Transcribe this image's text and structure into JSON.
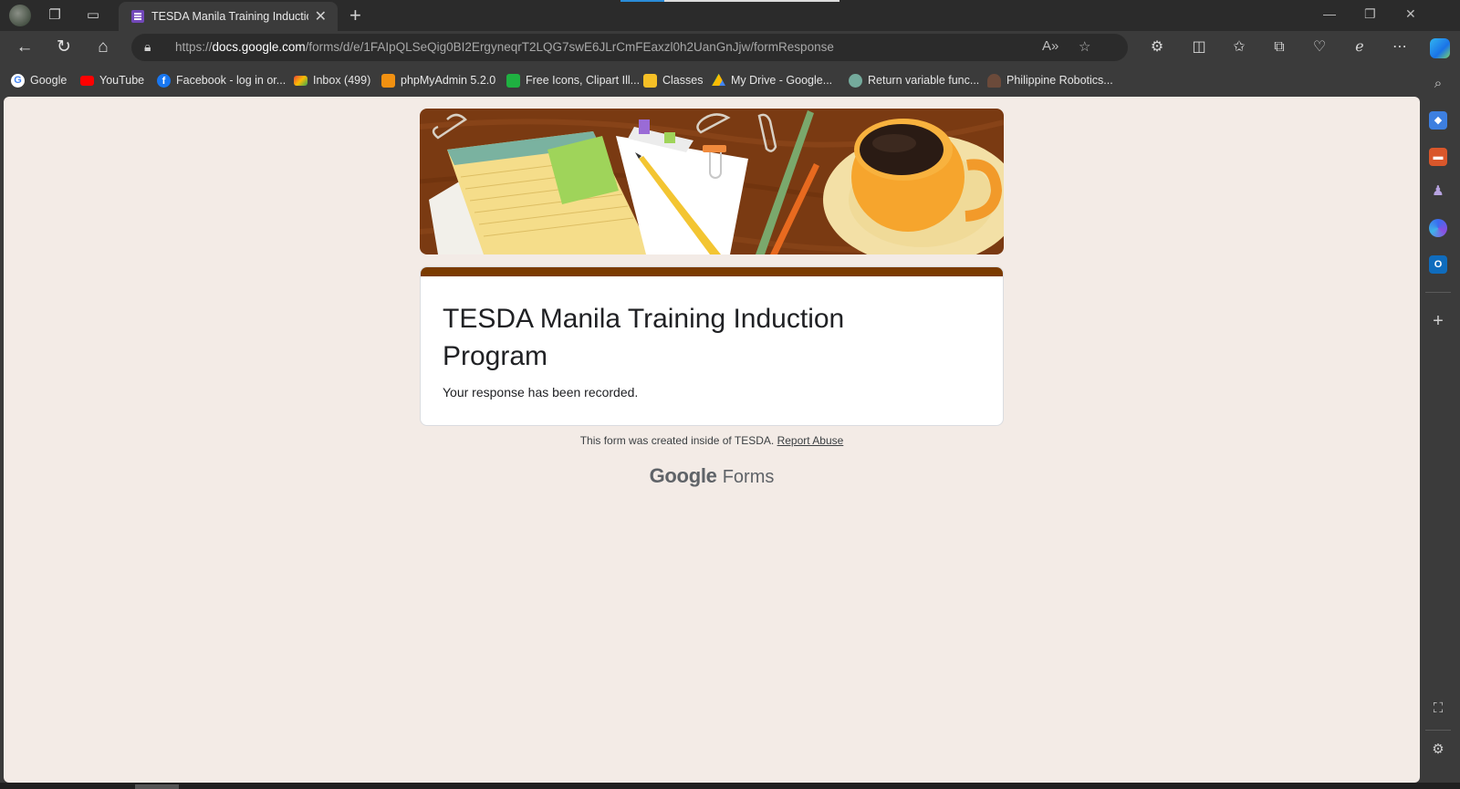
{
  "browser": {
    "tab": {
      "title": "TESDA Manila Training Induction Program"
    },
    "url": {
      "scheme": "https://",
      "host": "docs.google.com",
      "path": "/forms/d/e/1FAIpQLSeQig0BI2ErgyneqrT2LQG7swE6JLrCmFEaxzl0h2UanGnJjw/formResponse"
    },
    "bookmarks": [
      {
        "label": "Google",
        "icon": "google-icon",
        "color": "#ffffff"
      },
      {
        "label": "YouTube",
        "icon": "youtube-icon",
        "color": "#ff0000"
      },
      {
        "label": "Facebook - log in or...",
        "icon": "facebook-icon",
        "color": "#1877f2"
      },
      {
        "label": "Inbox (499)",
        "icon": "gmail-icon",
        "color": "#ea4335"
      },
      {
        "label": "phpMyAdmin 5.2.0",
        "icon": "phpmyadmin-icon",
        "color": "#f29111"
      },
      {
        "label": "Free Icons, Clipart Ill...",
        "icon": "icons8-icon",
        "color": "#1fb141"
      },
      {
        "label": "Classes",
        "icon": "classroom-icon",
        "color": "#f6c026"
      },
      {
        "label": "My Drive - Google...",
        "icon": "drive-icon",
        "color": "#34a853"
      },
      {
        "label": "Return variable func...",
        "icon": "chatgpt-icon",
        "color": "#74aa9c"
      },
      {
        "label": "Philippine Robotics...",
        "icon": "robotics-icon",
        "color": "#6b4a3a"
      }
    ]
  },
  "form": {
    "title": "TESDA Manila Training Induction Program",
    "confirmation": "Your response has been recorded.",
    "theme_color": "#7b3b00"
  },
  "footer": {
    "note": "This form was created inside of TESDA.",
    "report_link": "Report Abuse",
    "brand_google": "Google",
    "brand_forms": "Forms"
  }
}
